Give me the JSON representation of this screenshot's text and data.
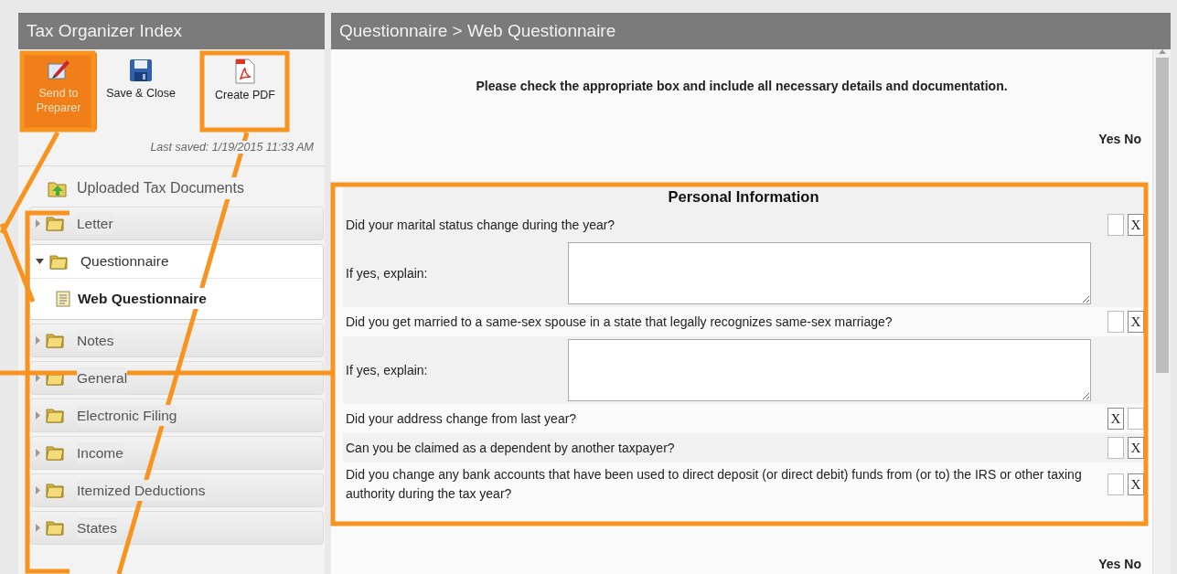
{
  "left_panel": {
    "title": "Tax Organizer Index",
    "toolbar": [
      {
        "kind": "send",
        "label": "Send to Preparer",
        "active": true
      },
      {
        "kind": "save",
        "label": "Save & Close",
        "active": false
      },
      {
        "kind": "pdf",
        "label": "Create PDF",
        "active": false
      }
    ],
    "last_saved": "Last saved: 1/19/2015 11:33 AM",
    "uploaded": "Uploaded Tax Documents",
    "tree": [
      {
        "label": "Letter",
        "expanded": false
      },
      {
        "label": "Questionnaire",
        "expanded": true,
        "children": [
          {
            "label": "Web Questionnaire",
            "selected": true
          }
        ]
      },
      {
        "label": "Notes",
        "expanded": false
      },
      {
        "label": "General",
        "expanded": false
      },
      {
        "label": "Electronic Filing",
        "expanded": false
      },
      {
        "label": "Income",
        "expanded": false
      },
      {
        "label": "Itemized Deductions",
        "expanded": false
      },
      {
        "label": "States",
        "expanded": false
      }
    ]
  },
  "main_panel": {
    "breadcrumb": "Questionnaire > Web Questionnaire",
    "instructions": "Please check the appropriate box and include all necessary details and documentation.",
    "header_yes": "Yes",
    "header_no": "No",
    "section": {
      "title": "Personal Information",
      "rows": [
        {
          "kind": "yesno",
          "text": "Did your marital status change during the year?",
          "yes": {
            "checked": false
          },
          "no": {
            "checked": true,
            "mark": "X"
          }
        },
        {
          "kind": "explain",
          "text": "If yes, explain:"
        },
        {
          "kind": "yesno",
          "text": "Did you get married to a same-sex spouse in a state that legally recognizes same-sex marriage?",
          "yes": {
            "checked": false
          },
          "no": {
            "checked": true,
            "mark": "X"
          }
        },
        {
          "kind": "explain",
          "text": "If yes, explain:"
        },
        {
          "kind": "yesno",
          "text": "Did your address change from last year?",
          "yes": {
            "checked": true,
            "mark": "X"
          },
          "no": {
            "checked": false
          }
        },
        {
          "kind": "yesno",
          "text": "Can you be claimed as a dependent by another taxpayer?",
          "yes": {
            "checked": false
          },
          "no": {
            "checked": true,
            "mark": "X"
          }
        },
        {
          "kind": "yesno",
          "text": "Did you change any bank accounts that have been used to direct deposit (or direct debit) funds from (or to) the IRS or other taxing authority during the tax year?",
          "yes": {
            "checked": false
          },
          "no": {
            "checked": true,
            "mark": "X"
          }
        }
      ]
    },
    "footer_yes": "Yes",
    "footer_no": "No"
  }
}
